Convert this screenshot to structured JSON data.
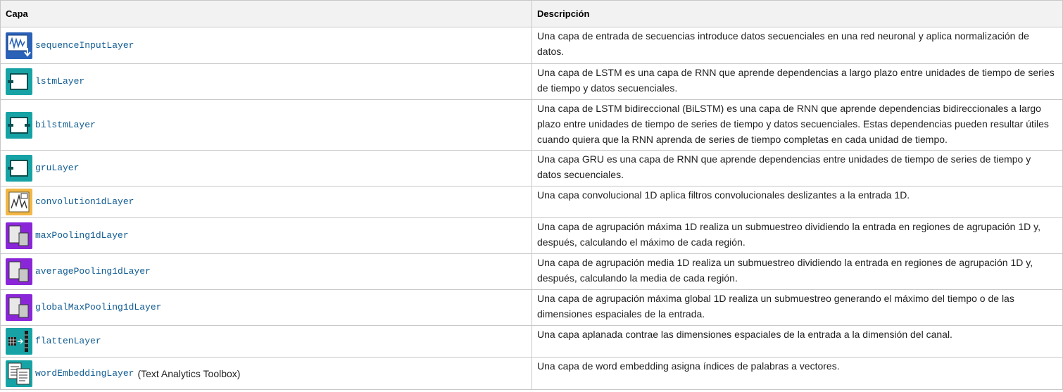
{
  "header": {
    "capa": "Capa",
    "descripcion": "Descripción"
  },
  "colors": {
    "link": "#0f5b92",
    "teal": "#17a3a5",
    "purple": "#8a26d8",
    "orange": "#f3b746"
  },
  "rows": [
    {
      "icon": "sequence-input-icon",
      "name": "sequenceInputLayer",
      "desc": "Una capa de entrada de secuencias introduce datos secuenciales en una red neuronal y aplica normalización de datos."
    },
    {
      "icon": "lstm-icon",
      "name": "lstmLayer",
      "desc": "Una capa de LSTM es una capa de RNN que aprende dependencias a largo plazo entre unidades de tiempo de series de tiempo y datos secuenciales."
    },
    {
      "icon": "bilstm-icon",
      "name": "bilstmLayer",
      "desc": "Una capa de LSTM bidireccional (BiLSTM) es una capa de RNN que aprende dependencias bidireccionales a largo plazo entre unidades de tiempo de series de tiempo y datos secuenciales. Estas dependencias pueden resultar útiles cuando quiera que la RNN aprenda de series de tiempo completas en cada unidad de tiempo."
    },
    {
      "icon": "gru-icon",
      "name": "gruLayer",
      "desc": "Una capa GRU es una capa de RNN que aprende dependencias entre unidades de tiempo de series de tiempo y datos secuenciales."
    },
    {
      "icon": "convolution-icon",
      "name": "convolution1dLayer",
      "desc": "Una capa convolucional 1D aplica filtros convolucionales deslizantes a la entrada 1D."
    },
    {
      "icon": "max-pooling-icon",
      "name": "maxPooling1dLayer",
      "desc": "Una capa de agrupación máxima 1D realiza un submuestreo dividiendo la entrada en regiones de agrupación 1D y, después, calculando el máximo de cada región."
    },
    {
      "icon": "average-pooling-icon",
      "name": "averagePooling1dLayer",
      "desc": "Una capa de agrupación media 1D realiza un submuestreo dividiendo la entrada en regiones de agrupación 1D y, después, calculando la media de cada región."
    },
    {
      "icon": "global-max-pooling-icon",
      "name": "globalMaxPooling1dLayer",
      "desc": "Una capa de agrupación máxima global 1D realiza un submuestreo generando el máximo del tiempo o de las dimensiones espaciales de la entrada."
    },
    {
      "icon": "flatten-icon",
      "name": "flattenLayer",
      "desc": "Una capa aplanada contrae las dimensiones espaciales de la entrada a la dimensión del canal."
    },
    {
      "icon": "word-embedding-icon",
      "name": "wordEmbeddingLayer",
      "suffix": "(Text Analytics Toolbox)",
      "desc": "Una capa de word embedding asigna índices de palabras a vectores."
    }
  ]
}
